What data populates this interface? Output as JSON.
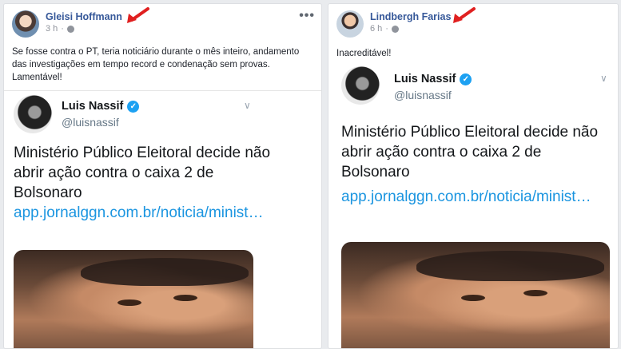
{
  "posts": [
    {
      "author": "Gleisi Hoffmann",
      "time": "3 h",
      "text": "Se fosse contra o PT, teria noticiário durante o mês inteiro, andamento das investigações em tempo record e condenação sem provas. Lamentável!",
      "more_icon": "more-dots-icon",
      "tweet": {
        "name": "Luis Nassif",
        "handle": "@luisnassif",
        "body": "Ministério Público Eleitoral decide não abrir ação contra o caixa 2 de Bolsonaro",
        "link": "app.jornalggn.com.br/noticia/minist…"
      }
    },
    {
      "author": "Lindbergh Farias",
      "time": "6 h",
      "text": "Inacreditável!",
      "tweet": {
        "name": "Luis Nassif",
        "handle": "@luisnassif",
        "body": "Ministério Público Eleitoral decide não abrir ação contra o caixa 2 de Bolsonaro",
        "link": "app.jornalggn.com.br/noticia/minist…"
      }
    }
  ],
  "colors": {
    "author": "#365899",
    "link": "#1b95e0",
    "arrow": "#e02020",
    "verified": "#1da1f2"
  }
}
